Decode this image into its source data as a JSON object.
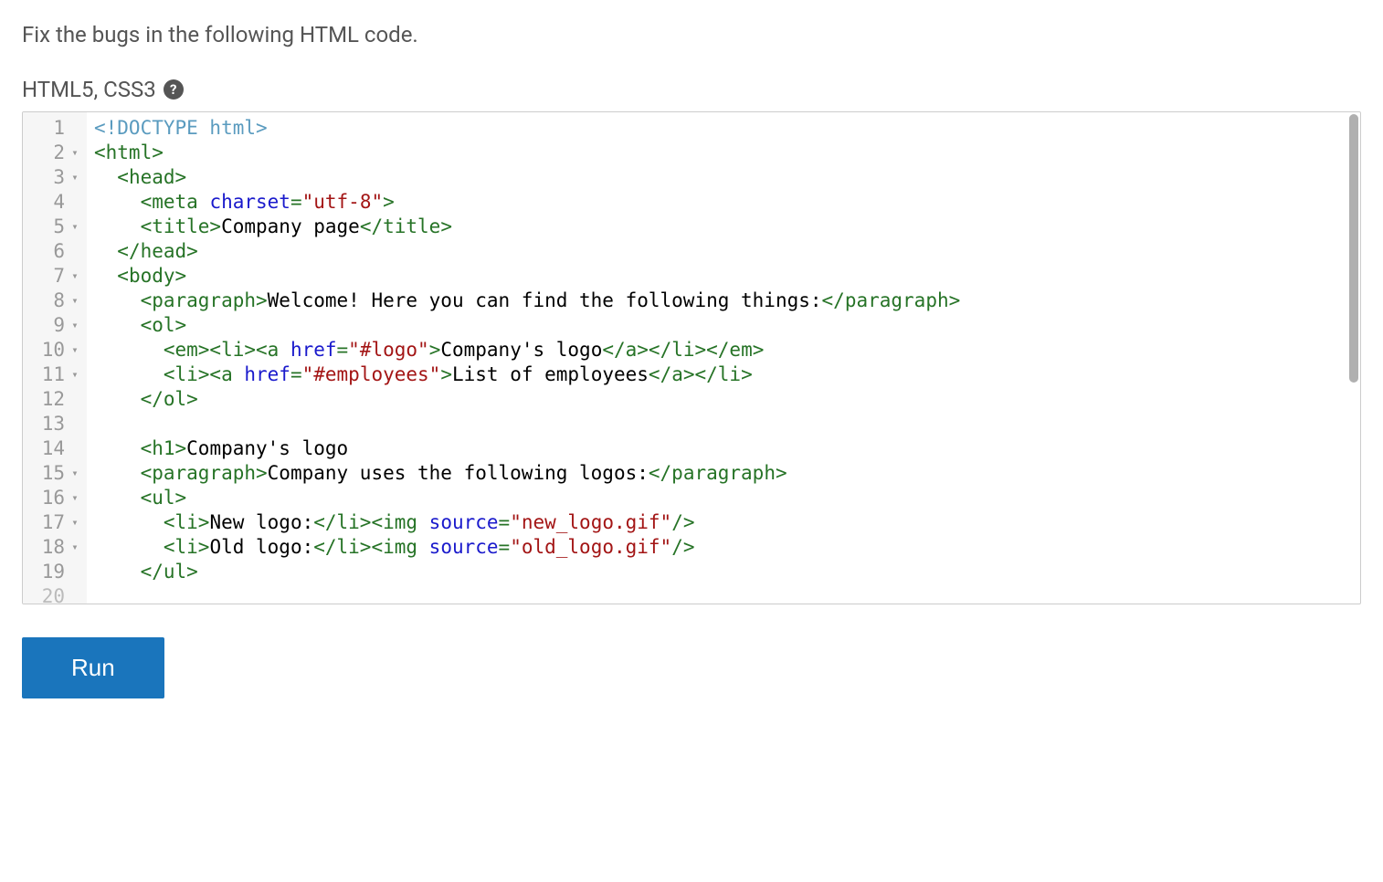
{
  "instruction": "Fix the bugs in the following HTML code.",
  "language_label": "HTML5, CSS3",
  "help_icon_glyph": "?",
  "run_label": "Run",
  "scrollbar": {
    "thumb_height_pct": 55
  },
  "gutter": [
    {
      "num": "1",
      "fold": ""
    },
    {
      "num": "2",
      "fold": "▾"
    },
    {
      "num": "3",
      "fold": "▾"
    },
    {
      "num": "4",
      "fold": ""
    },
    {
      "num": "5",
      "fold": "▾"
    },
    {
      "num": "6",
      "fold": ""
    },
    {
      "num": "7",
      "fold": "▾"
    },
    {
      "num": "8",
      "fold": "▾"
    },
    {
      "num": "9",
      "fold": "▾"
    },
    {
      "num": "10",
      "fold": "▾"
    },
    {
      "num": "11",
      "fold": "▾"
    },
    {
      "num": "12",
      "fold": ""
    },
    {
      "num": "13",
      "fold": ""
    },
    {
      "num": "14",
      "fold": ""
    },
    {
      "num": "15",
      "fold": "▾"
    },
    {
      "num": "16",
      "fold": "▾"
    },
    {
      "num": "17",
      "fold": "▾"
    },
    {
      "num": "18",
      "fold": "▾"
    },
    {
      "num": "19",
      "fold": ""
    },
    {
      "num": "20",
      "fold": ""
    }
  ],
  "code": {
    "lines": [
      {
        "indent": 0,
        "tokens": [
          {
            "t": "<!DOCTYPE html>",
            "c": "doctype"
          }
        ]
      },
      {
        "indent": 0,
        "tokens": [
          {
            "t": "<html>",
            "c": "tag"
          }
        ]
      },
      {
        "indent": 1,
        "tokens": [
          {
            "t": "<head>",
            "c": "tag"
          }
        ]
      },
      {
        "indent": 2,
        "tokens": [
          {
            "t": "<meta ",
            "c": "tag"
          },
          {
            "t": "charset",
            "c": "attr-name"
          },
          {
            "t": "=",
            "c": "tag"
          },
          {
            "t": "\"utf-8\"",
            "c": "attr-val"
          },
          {
            "t": ">",
            "c": "tag"
          }
        ]
      },
      {
        "indent": 2,
        "tokens": [
          {
            "t": "<title>",
            "c": "tag"
          },
          {
            "t": "Company page",
            "c": "text"
          },
          {
            "t": "</title>",
            "c": "tag"
          }
        ]
      },
      {
        "indent": 1,
        "tokens": [
          {
            "t": "</head>",
            "c": "tag"
          }
        ]
      },
      {
        "indent": 1,
        "tokens": [
          {
            "t": "<body>",
            "c": "tag"
          }
        ]
      },
      {
        "indent": 2,
        "tokens": [
          {
            "t": "<paragraph>",
            "c": "tag"
          },
          {
            "t": "Welcome! Here you can find the following things:",
            "c": "text"
          },
          {
            "t": "</paragraph>",
            "c": "tag"
          }
        ]
      },
      {
        "indent": 2,
        "tokens": [
          {
            "t": "<ol>",
            "c": "tag"
          }
        ]
      },
      {
        "indent": 3,
        "tokens": [
          {
            "t": "<em><li><a ",
            "c": "tag"
          },
          {
            "t": "href",
            "c": "attr-name"
          },
          {
            "t": "=",
            "c": "tag"
          },
          {
            "t": "\"#logo\"",
            "c": "attr-val"
          },
          {
            "t": ">",
            "c": "tag"
          },
          {
            "t": "Company's logo",
            "c": "text"
          },
          {
            "t": "</a></li></em>",
            "c": "tag"
          }
        ]
      },
      {
        "indent": 3,
        "tokens": [
          {
            "t": "<li><a ",
            "c": "tag"
          },
          {
            "t": "href",
            "c": "attr-name"
          },
          {
            "t": "=",
            "c": "tag"
          },
          {
            "t": "\"#employees\"",
            "c": "attr-val"
          },
          {
            "t": ">",
            "c": "tag"
          },
          {
            "t": "List of employees",
            "c": "text"
          },
          {
            "t": "</a></li>",
            "c": "tag"
          }
        ]
      },
      {
        "indent": 2,
        "tokens": [
          {
            "t": "</ol>",
            "c": "tag"
          }
        ]
      },
      {
        "indent": 0,
        "tokens": []
      },
      {
        "indent": 2,
        "tokens": [
          {
            "t": "<h1>",
            "c": "tag"
          },
          {
            "t": "Company's logo",
            "c": "text"
          }
        ]
      },
      {
        "indent": 2,
        "tokens": [
          {
            "t": "<paragraph>",
            "c": "tag"
          },
          {
            "t": "Company uses the following logos:",
            "c": "text"
          },
          {
            "t": "</paragraph>",
            "c": "tag"
          }
        ]
      },
      {
        "indent": 2,
        "tokens": [
          {
            "t": "<ul>",
            "c": "tag"
          }
        ]
      },
      {
        "indent": 3,
        "tokens": [
          {
            "t": "<li>",
            "c": "tag"
          },
          {
            "t": "New logo:",
            "c": "text"
          },
          {
            "t": "</li><img ",
            "c": "tag"
          },
          {
            "t": "source",
            "c": "attr-name"
          },
          {
            "t": "=",
            "c": "tag"
          },
          {
            "t": "\"new_logo.gif\"",
            "c": "attr-val"
          },
          {
            "t": "/>",
            "c": "tag"
          }
        ]
      },
      {
        "indent": 3,
        "tokens": [
          {
            "t": "<li>",
            "c": "tag"
          },
          {
            "t": "Old logo:",
            "c": "text"
          },
          {
            "t": "</li><img ",
            "c": "tag"
          },
          {
            "t": "source",
            "c": "attr-name"
          },
          {
            "t": "=",
            "c": "tag"
          },
          {
            "t": "\"old_logo.gif\"",
            "c": "attr-val"
          },
          {
            "t": "/>",
            "c": "tag"
          }
        ]
      },
      {
        "indent": 2,
        "tokens": [
          {
            "t": "</ul>",
            "c": "tag"
          }
        ]
      },
      {
        "indent": 0,
        "tokens": []
      }
    ]
  }
}
